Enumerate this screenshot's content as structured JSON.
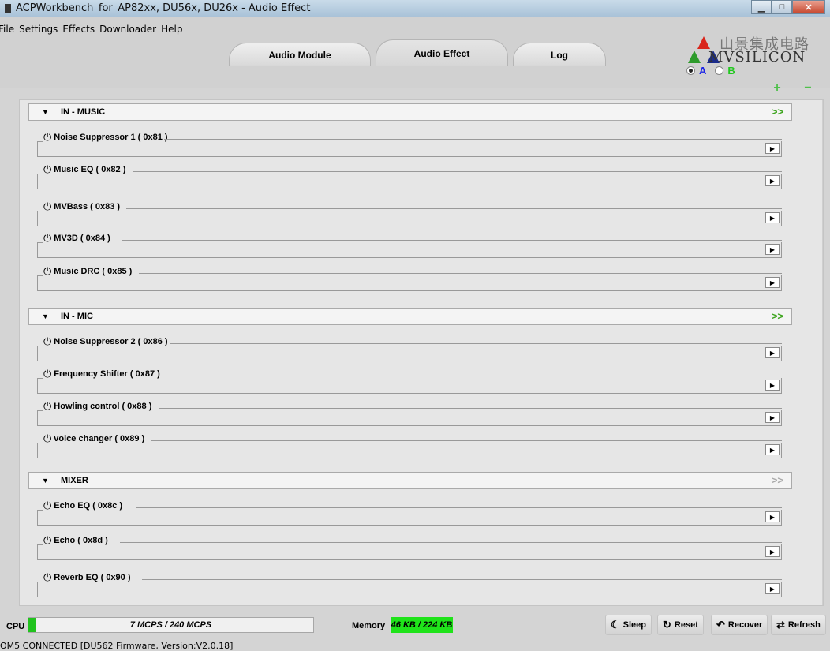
{
  "window": {
    "title": "ACPWorkbench_for_AP82xx, DU56x, DU26x - Audio Effect"
  },
  "menu": [
    "File",
    "Settings",
    "Effects",
    "Downloader",
    "Help"
  ],
  "tabs": [
    "Audio Module",
    "Audio Effect",
    "Log"
  ],
  "active_tab": "Audio Effect",
  "logo": {
    "cn": "山景集成电路",
    "en": "MVSILICON"
  },
  "profile": {
    "a_label": "A",
    "b_label": "B",
    "selected": "A"
  },
  "buttons": {
    "plus": "+",
    "minus": "−"
  },
  "groups": [
    {
      "title": "IN - MUSIC",
      "modules": [
        "Noise Suppressor 1 ( 0x81 )",
        "Music EQ ( 0x82 )",
        "MVBass ( 0x83 )",
        "MV3D ( 0x84 )",
        "Music DRC ( 0x85 )"
      ]
    },
    {
      "title": "IN - MIC",
      "modules": [
        "Noise Suppressor 2 ( 0x86 )",
        "Frequency Shifter ( 0x87 )",
        "Howling control ( 0x88 )",
        "voice changer ( 0x89 )"
      ]
    },
    {
      "title": "MIXER",
      "modules": [
        "Echo EQ ( 0x8c )",
        "Echo ( 0x8d )",
        "Reverb EQ ( 0x90 )"
      ]
    }
  ],
  "status": {
    "cpu_label": "CPU",
    "cpu_value": "7 MCPS / 240 MCPS",
    "cpu_fraction": 0.029,
    "memory_label": "Memory",
    "memory_value": "46 KB / 224 KB",
    "sleep": "Sleep",
    "reset": "Reset",
    "recover": "Recover",
    "refresh": "Refresh",
    "connection": "OM5 CONNECTED [DU562 Firmware, Version:V2.0.18]"
  },
  "colors": {
    "accent_green": "#20c31d",
    "label_a": "#1b24e6",
    "label_b": "#22c81f"
  }
}
